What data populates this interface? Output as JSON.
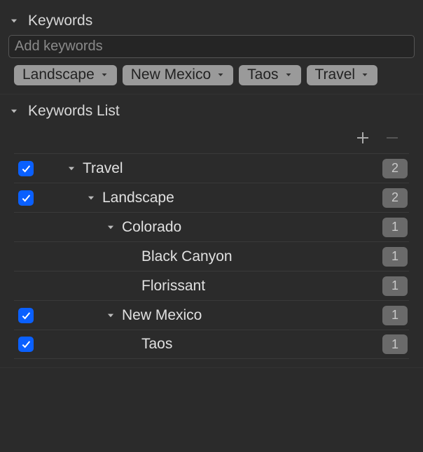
{
  "sections": {
    "keywords": {
      "title": "Keywords"
    },
    "keywords_list": {
      "title": "Keywords List"
    }
  },
  "keyword_input": {
    "placeholder": "Add keywords",
    "value": ""
  },
  "tags": [
    {
      "label": "Landscape"
    },
    {
      "label": "New Mexico"
    },
    {
      "label": "Taos"
    },
    {
      "label": "Travel"
    }
  ],
  "tree": [
    {
      "indent": 0,
      "label": "Travel",
      "count": "2",
      "checked": true,
      "hasCheck": true,
      "expandable": true
    },
    {
      "indent": 1,
      "label": "Landscape",
      "count": "2",
      "checked": true,
      "hasCheck": true,
      "expandable": true
    },
    {
      "indent": 2,
      "label": "Colorado",
      "count": "1",
      "checked": false,
      "hasCheck": false,
      "expandable": true
    },
    {
      "indent": 3,
      "label": "Black Canyon",
      "count": "1",
      "checked": false,
      "hasCheck": false,
      "expandable": false
    },
    {
      "indent": 3,
      "label": "Florissant",
      "count": "1",
      "checked": false,
      "hasCheck": false,
      "expandable": false
    },
    {
      "indent": 2,
      "label": "New Mexico",
      "count": "1",
      "checked": true,
      "hasCheck": true,
      "expandable": true
    },
    {
      "indent": 3,
      "label": "Taos",
      "count": "1",
      "checked": true,
      "hasCheck": true,
      "expandable": false
    }
  ]
}
